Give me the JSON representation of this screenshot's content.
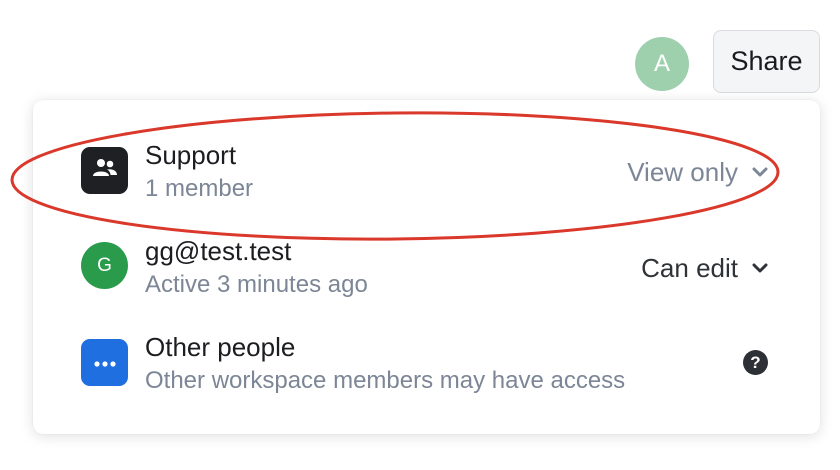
{
  "topbar": {
    "avatar_initial": "A",
    "share_label": "Share"
  },
  "share_panel": {
    "rows": [
      {
        "title": "Support",
        "subtitle": "1 member",
        "permission": "View only",
        "icon": "group-icon",
        "icon_color": "#1f2023"
      },
      {
        "title": "gg@test.test",
        "subtitle": "Active 3 minutes ago",
        "permission": "Can edit",
        "icon_initial": "G",
        "icon_color": "#2a9a4b"
      },
      {
        "title": "Other people",
        "subtitle": "Other workspace members may have access",
        "icon": "ellipsis-icon",
        "icon_color": "#1f6fe0",
        "help_symbol": "?"
      }
    ]
  },
  "annotation": {
    "type": "ellipse",
    "color": "#d9382a",
    "target": "Support"
  },
  "colors": {
    "share_bg": "#f4f5f6",
    "muted_text": "#7c8696",
    "avatar_a": "#9ed0ae"
  }
}
